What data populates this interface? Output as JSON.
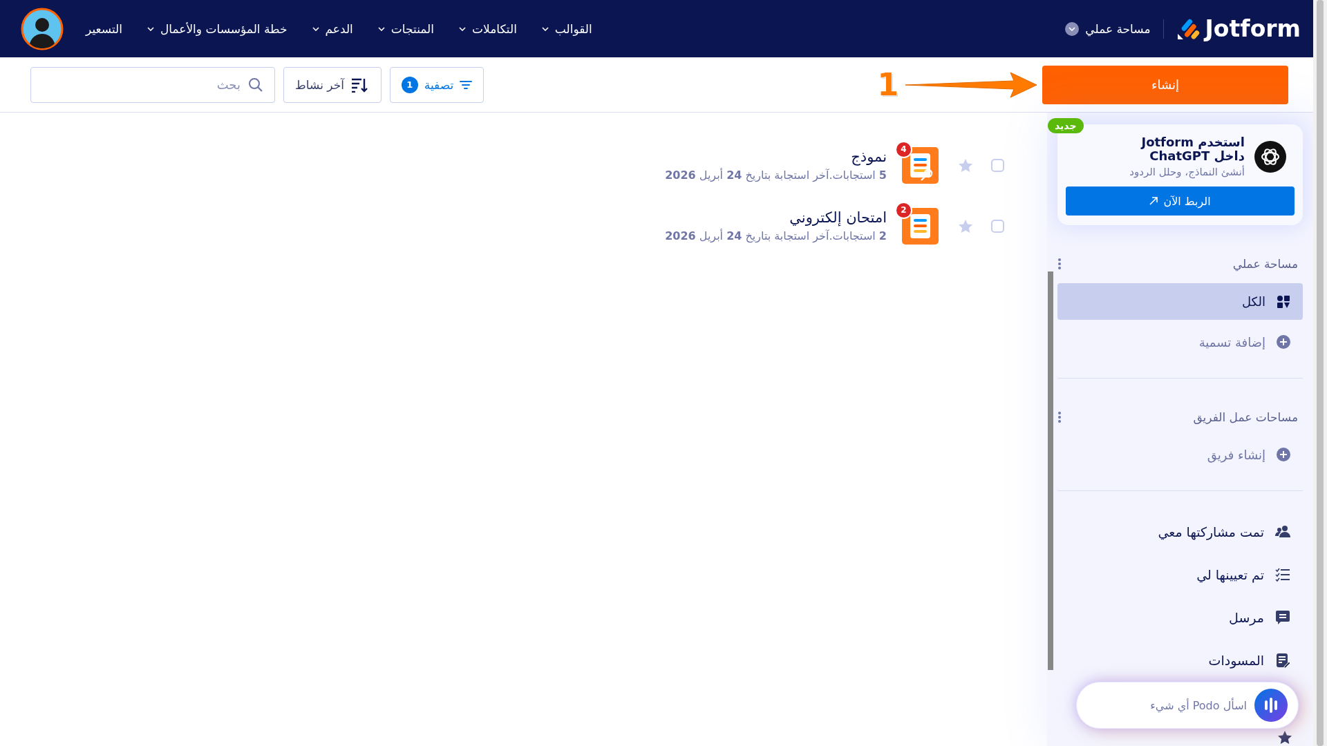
{
  "nav": {
    "logo": "Jotform",
    "workspace": "مساحة عملي",
    "menu": [
      {
        "label": "القوالب",
        "dropdown": true
      },
      {
        "label": "التكاملات",
        "dropdown": true
      },
      {
        "label": "المنتجات",
        "dropdown": true
      },
      {
        "label": "الدعم",
        "dropdown": true
      },
      {
        "label": "خطة المؤسسات والأعمال",
        "dropdown": true
      },
      {
        "label": "التسعير",
        "dropdown": false
      }
    ]
  },
  "toolbar": {
    "create": "إنشاء",
    "annotation": "1",
    "filter": {
      "label": "تصفية",
      "count": "1"
    },
    "sort": "آخر نشاط",
    "search": {
      "placeholder": "بحث"
    }
  },
  "forms": [
    {
      "kind": "key",
      "title": "نموذج",
      "meta": "**5** استجابات.آخر استجابة بتاريخ **24** أبريل **2026**",
      "badge": "4",
      "starred": false,
      "checked": false
    },
    {
      "kind": "plain",
      "title": "امتحان إلكتروني",
      "meta": "**2** استجابات.آخر استجابة بتاريخ **24** أبريل **2026**",
      "badge": "2",
      "starred": false,
      "checked": false
    }
  ],
  "sidebar": {
    "promo": {
      "badge": "جديد",
      "title": "استخدم Jotform داخل ChatGPT",
      "subtitle": "أنشئ النماذج، وحلل الردود",
      "button": "الربط الآن"
    },
    "workspace": {
      "heading": "مساحة عملي",
      "items": [
        {
          "label": "الكل",
          "selected": true
        }
      ],
      "add": "إضافة تسمية"
    },
    "teams": {
      "heading": "مساحات عمل الفريق",
      "add": "إنشاء فريق"
    },
    "links": [
      {
        "kind": "shared",
        "label": "تمت مشاركتها معي",
        "selected": false
      },
      {
        "kind": "assigned",
        "label": "تم تعيينها لي",
        "selected": false
      },
      {
        "kind": "sent",
        "label": "مرسل",
        "selected": false
      },
      {
        "kind": "drafts",
        "label": "المسودات",
        "selected": false
      }
    ]
  },
  "assistant": {
    "placeholder": "اسأل Podo أي شيء"
  }
}
